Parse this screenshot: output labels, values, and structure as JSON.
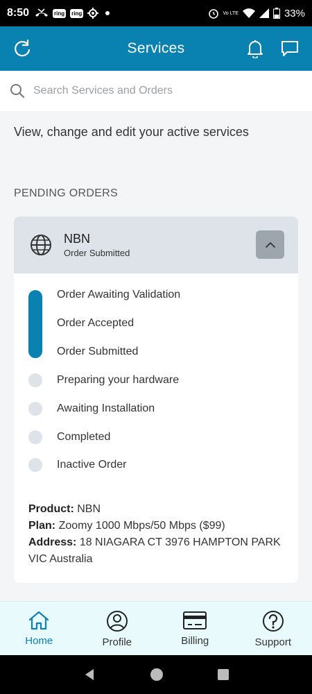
{
  "status_bar": {
    "time": "8:50",
    "ring_1": "ring",
    "ring_2": "ring",
    "volte": "Vo LTE",
    "battery": "33%"
  },
  "header": {
    "title": "Services",
    "color": "#0a82b1"
  },
  "search": {
    "placeholder": "Search Services and Orders"
  },
  "intro_text": "View, change and edit your active services",
  "section_title": "PENDING ORDERS",
  "order": {
    "name": "NBN",
    "status": "Order Submitted",
    "steps": [
      {
        "label": "Order Awaiting Validation",
        "completed": true
      },
      {
        "label": "Order Accepted",
        "completed": true
      },
      {
        "label": "Order Submitted",
        "completed": true
      },
      {
        "label": "Preparing your hardware",
        "completed": false
      },
      {
        "label": "Awaiting Installation",
        "completed": false
      },
      {
        "label": "Completed",
        "completed": false
      },
      {
        "label": "Inactive Order",
        "completed": false
      }
    ],
    "details": {
      "product_label": "Product:",
      "product_value": "NBN",
      "plan_label": "Plan:",
      "plan_value": "Zoomy 1000 Mbps/50 Mbps ($99)",
      "address_label": "Address:",
      "address_value": "18 NIAGARA CT 3976 HAMPTON PARK VIC Australia"
    }
  },
  "bottom_nav": [
    {
      "label": "Home",
      "icon": "home-icon",
      "active": true
    },
    {
      "label": "Profile",
      "icon": "profile-icon",
      "active": false
    },
    {
      "label": "Billing",
      "icon": "billing-card-icon",
      "active": false
    },
    {
      "label": "Support",
      "icon": "help-icon",
      "active": false
    }
  ]
}
